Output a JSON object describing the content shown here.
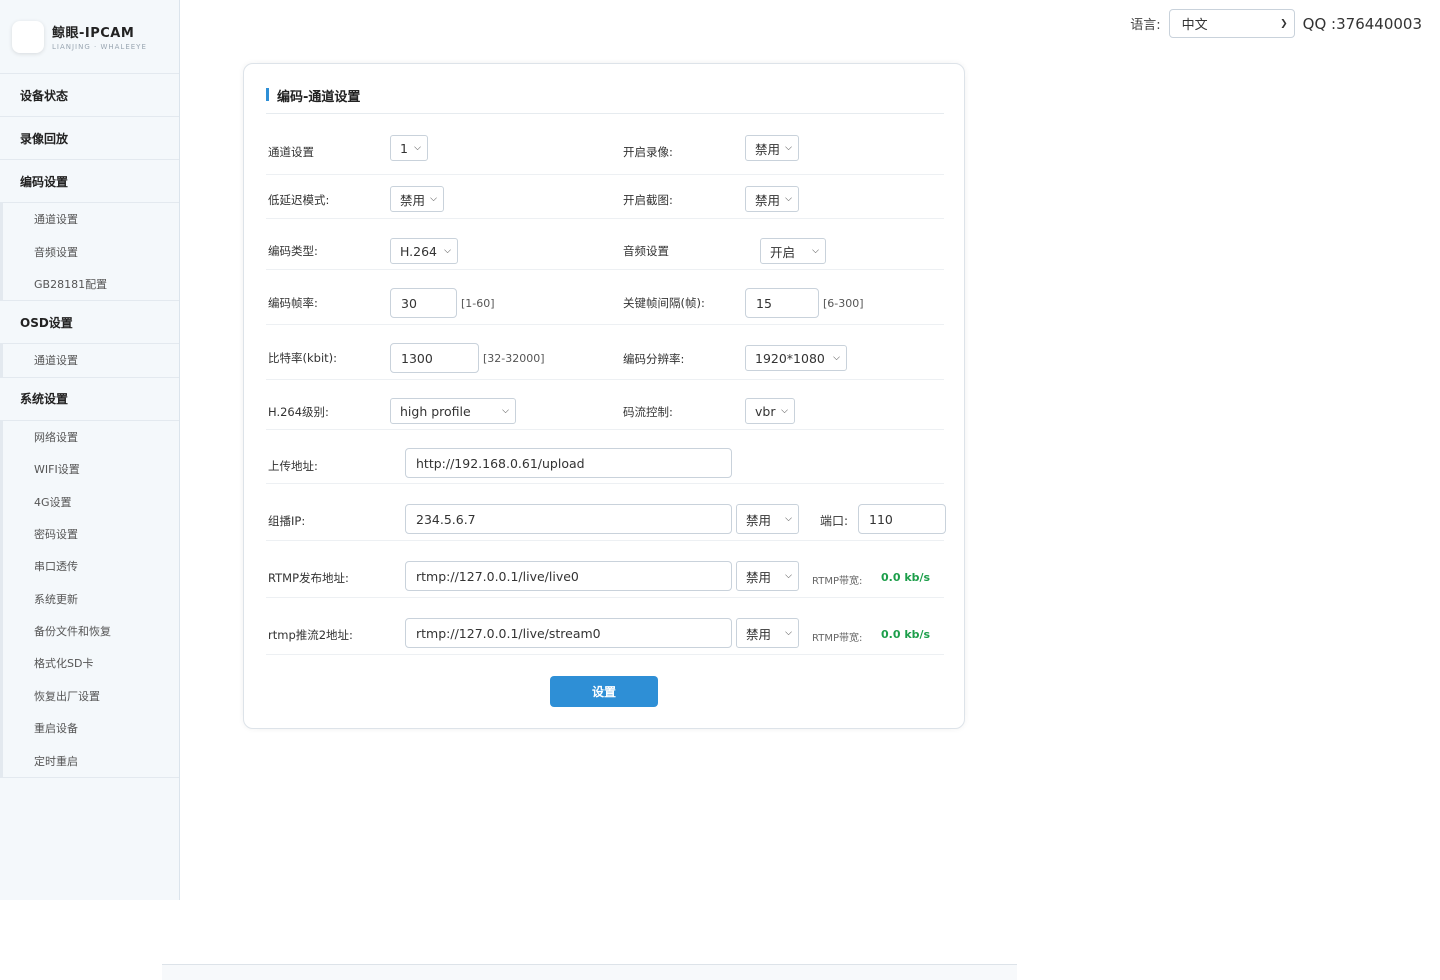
{
  "brand": {
    "title": "鲸眼-IPCAM",
    "subtitle": "LIANJING · WHALEEYE"
  },
  "topbar": {
    "lang_label": "语言:",
    "lang_value": "中文",
    "qq": "QQ :376440003"
  },
  "sidebar": {
    "g1": "设备状态",
    "g2": "录像回放",
    "g3": "编码设置",
    "g3_items": [
      "通道设置",
      "音频设置",
      "GB28181配置"
    ],
    "g4": "OSD设置",
    "g4_items": [
      "通道设置"
    ],
    "g5": "系统设置",
    "g5_items": [
      "网络设置",
      "WIFI设置",
      "4G设置",
      "密码设置",
      "串口透传",
      "系统更新",
      "备份文件和恢复",
      "格式化SD卡",
      "恢复出厂设置",
      "重启设备",
      "定时重启"
    ]
  },
  "form": {
    "title": "编码-通道设置",
    "channel": {
      "label": "通道设置",
      "value": "1"
    },
    "record": {
      "label": "开启录像:",
      "value": "禁用"
    },
    "low_latency": {
      "label": "低延迟模式:",
      "value": "禁用"
    },
    "snapshot": {
      "label": "开启截图:",
      "value": "禁用"
    },
    "codec": {
      "label": "编码类型:",
      "value": "H.264"
    },
    "audio": {
      "label": "音频设置",
      "value": "开启"
    },
    "fps": {
      "label": "编码帧率:",
      "value": "30",
      "hint": "[1-60]"
    },
    "gop": {
      "label": "关键帧间隔(帧):",
      "value": "15",
      "hint": "[6-300]"
    },
    "bitrate": {
      "label": "比特率(kbit):",
      "value": "1300",
      "hint": "[32-32000]"
    },
    "resolution": {
      "label": "编码分辨率:",
      "value": "1920*1080"
    },
    "profile": {
      "label": "H.264级别:",
      "value": "high profile"
    },
    "rate_ctrl": {
      "label": "码流控制:",
      "value": "vbr"
    },
    "upload": {
      "label": "上传地址:",
      "value": "http://192.168.0.61/upload"
    },
    "multicast": {
      "label": "组播IP:",
      "value": "234.5.6.7",
      "state": "禁用",
      "port_label": "端口:",
      "port": "110"
    },
    "rtmp1": {
      "label": "RTMP发布地址:",
      "value": "rtmp://127.0.0.1/live/live0",
      "state": "禁用",
      "bw_label": "RTMP带宽:",
      "bw": "0.0 kb/s"
    },
    "rtmp2": {
      "label": "rtmp推流2地址:",
      "value": "rtmp://127.0.0.1/live/stream0",
      "state": "禁用",
      "bw_label": "RTMP带宽:",
      "bw": "0.0 kb/s"
    },
    "submit": "设置"
  }
}
